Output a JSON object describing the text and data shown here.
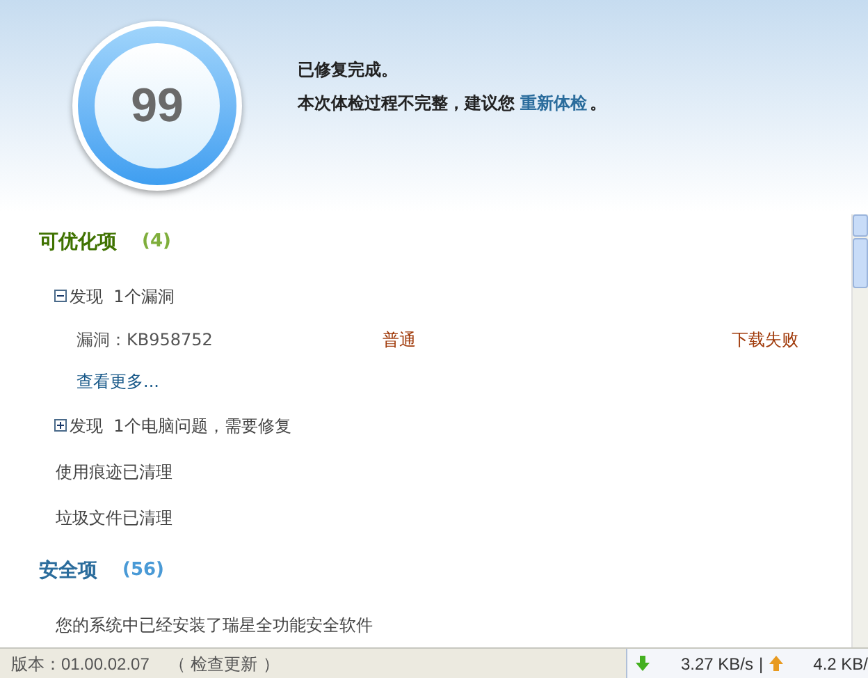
{
  "score": "99",
  "message": {
    "line1": "已修复完成。",
    "line2": "本次体检过程不完整，建议您",
    "link": "重新体检",
    "line2_end": "。"
  },
  "sections": [
    {
      "kind": "optimize",
      "title": "可优化项",
      "count": "(4)",
      "items": [
        {
          "kind": "group",
          "expanded": true,
          "text": "发现  1个漏洞",
          "children": [
            {
              "kind": "detail",
              "name": "漏洞：KB958752",
              "level": "普通",
              "status": "下载失败"
            },
            {
              "kind": "link",
              "text": "查看更多..."
            }
          ]
        },
        {
          "kind": "group",
          "expanded": false,
          "text": "发现  1个电脑问题，需要修复"
        },
        {
          "kind": "text",
          "text": "使用痕迹已清理"
        },
        {
          "kind": "text",
          "text": "垃圾文件已清理"
        }
      ]
    },
    {
      "kind": "security",
      "title": "安全项",
      "count": "(56)",
      "items": [
        {
          "kind": "text",
          "text": "您的系统中已经安装了瑞星全功能安全软件"
        }
      ]
    }
  ],
  "status_bar": {
    "version": "版本：01.00.02.07",
    "update": "（ 检查更新 ）",
    "download": "3.27 KB/s",
    "separator": "|",
    "upload": "4.2 KB/"
  }
}
